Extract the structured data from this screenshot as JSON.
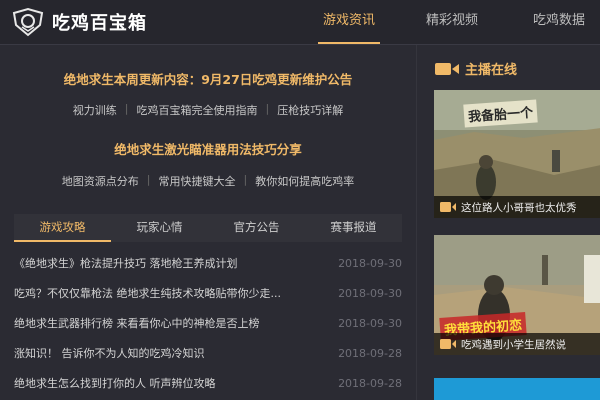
{
  "header": {
    "brand": "吃鸡百宝箱",
    "nav": [
      {
        "label": "游戏资讯",
        "active": true
      },
      {
        "label": "精彩视频",
        "active": false
      },
      {
        "label": "吃鸡数据",
        "active": false
      }
    ]
  },
  "headlines": [
    {
      "title": "绝地求生本周更新内容：9月27日吃鸡更新维护公告",
      "links": [
        "视力训练",
        "吃鸡百宝箱完全使用指南",
        "压枪技巧详解"
      ]
    },
    {
      "title": "绝地求生激光瞄准器用法技巧分享",
      "links": [
        "地图资源点分布",
        "常用快捷键大全",
        "教你如何提高吃鸡率"
      ]
    }
  ],
  "tabs": [
    {
      "label": "游戏攻略",
      "active": true
    },
    {
      "label": "玩家心情",
      "active": false
    },
    {
      "label": "官方公告",
      "active": false
    },
    {
      "label": "赛事报道",
      "active": false
    }
  ],
  "news": [
    {
      "title": "《绝地求生》枪法提升技巧 落地枪王养成计划",
      "date": "2018-09-30"
    },
    {
      "title": "吃鸡？不仅仅靠枪法 绝地求生纯技术攻略贴带你少走...",
      "date": "2018-09-30"
    },
    {
      "title": "绝地求生武器排行榜 来看看你心中的神枪是否上榜",
      "date": "2018-09-30"
    },
    {
      "title": "涨知识！ 告诉你不为人知的吃鸡冷知识",
      "date": "2018-09-28"
    },
    {
      "title": "绝地求生怎么找到打你的人 听声辨位攻略",
      "date": "2018-09-28"
    }
  ],
  "live": {
    "title": "主播在线",
    "videos": [
      {
        "overlay": "我备胎一个",
        "caption": "这位路人小哥哥也太优秀"
      },
      {
        "overlay": "我带我的初恋",
        "caption": "吃鸡遇到小学生居然说"
      }
    ]
  },
  "colors": {
    "accent": "#f0b968",
    "background": "#2b2b33",
    "header": "#26262d"
  }
}
